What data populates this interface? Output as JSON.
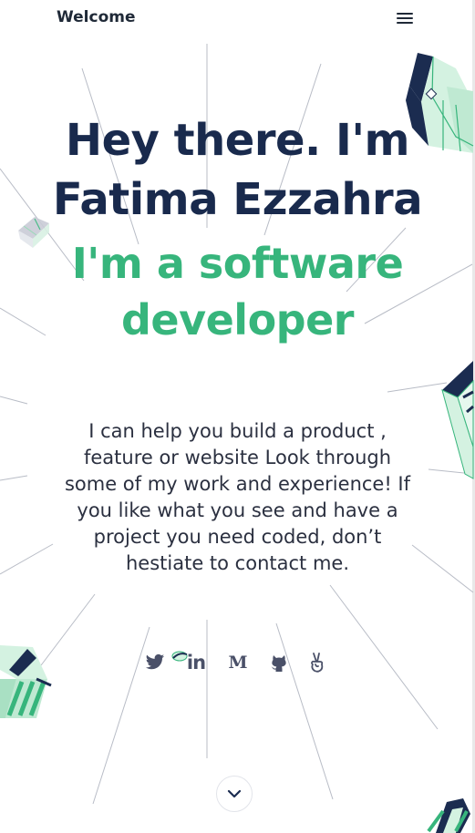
{
  "nav": {
    "brand": "Welcome",
    "menu_icon": "hamburger-menu-icon"
  },
  "hero": {
    "greeting_line1": "Hey there. I'm",
    "greeting_line2": "Fatima Ezzahra",
    "role_line1": "I'm a software",
    "role_line2": "developer"
  },
  "intro": {
    "lines": [
      "I can help you build a product ,",
      "feature or website Look through",
      "some of my work and experience! If",
      "you like what you see and have a",
      "project you need coded, don’t",
      "hestiate to contact me."
    ]
  },
  "socials": [
    {
      "name": "twitter",
      "icon": "twitter-icon"
    },
    {
      "name": "linkedin",
      "icon": "linkedin-icon",
      "text": "in"
    },
    {
      "name": "medium",
      "icon": "medium-icon",
      "text": "M"
    },
    {
      "name": "github",
      "icon": "github-icon"
    },
    {
      "name": "angellist",
      "icon": "angellist-icon"
    }
  ],
  "scroll_down": {
    "icon": "chevron-down-icon"
  },
  "colors": {
    "navy": "#192a4d",
    "green": "#37b57c",
    "mint": "#cdeedd",
    "text": "#2b3040",
    "icon": "#4a5068"
  }
}
